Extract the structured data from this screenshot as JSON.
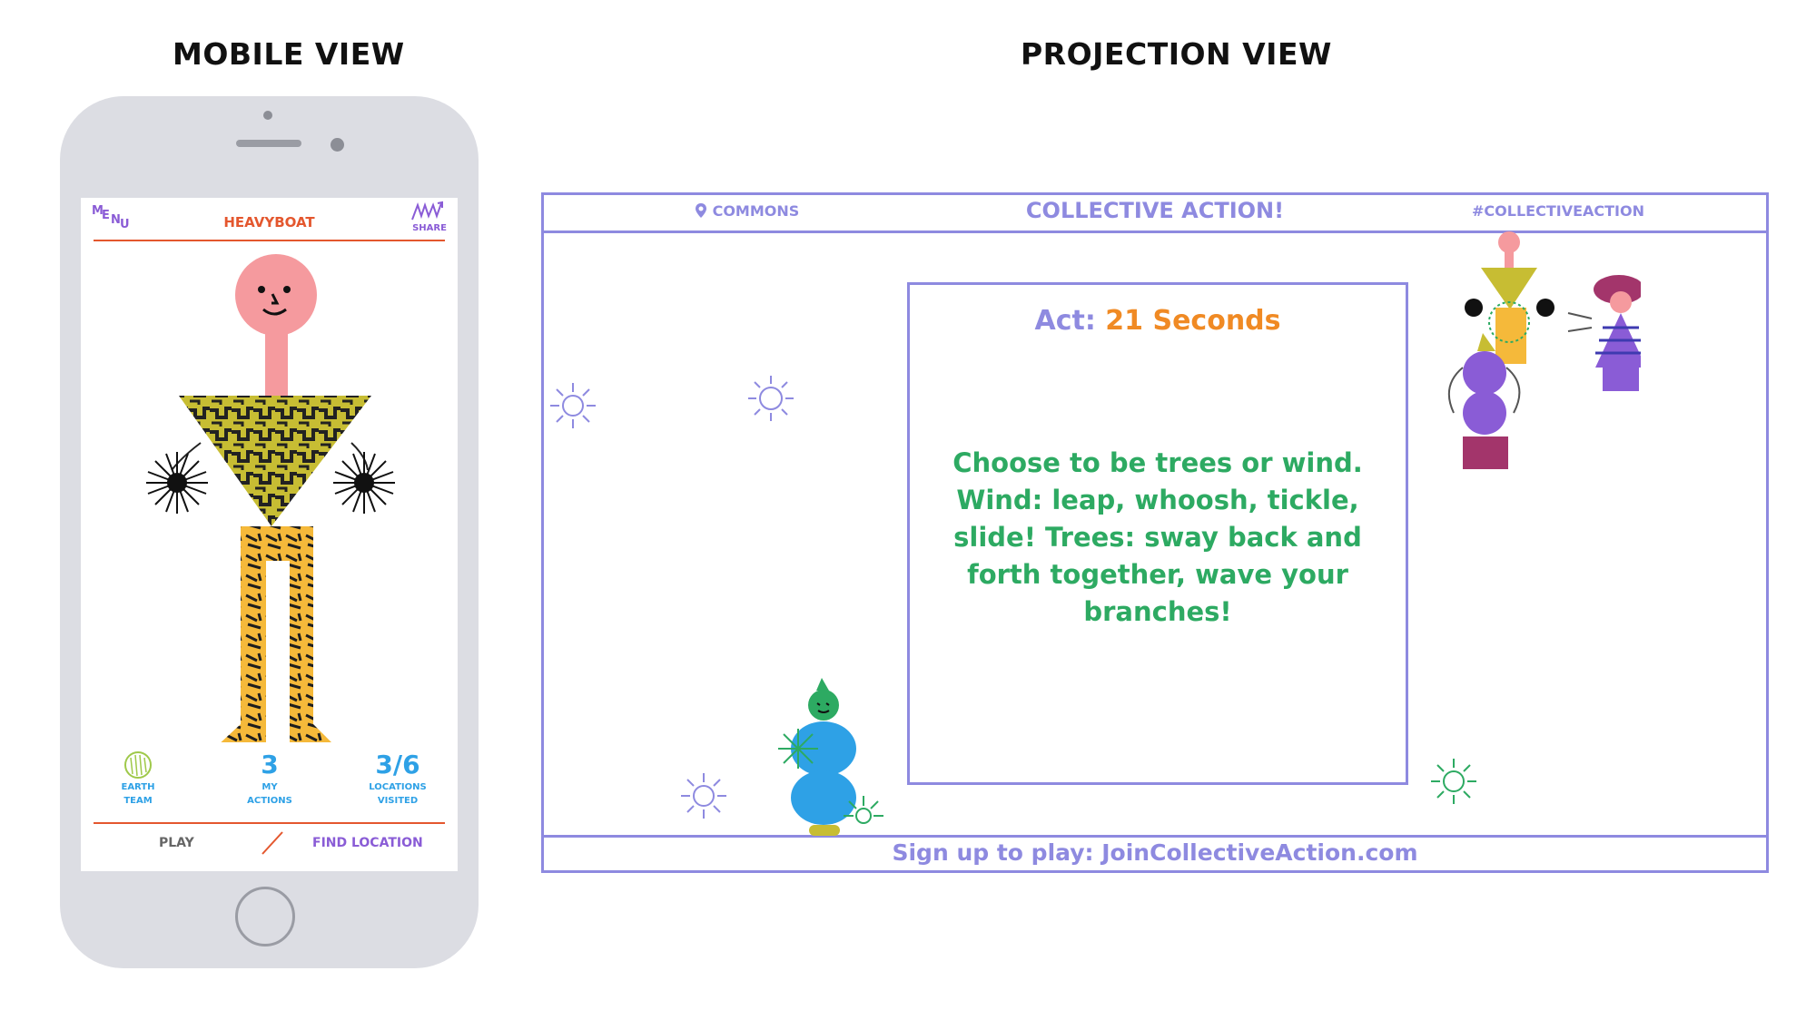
{
  "headings": {
    "mobile": "MOBILE VIEW",
    "projection": "PROJECTION VIEW"
  },
  "mobile": {
    "menu_label": "MENU",
    "menu_letters": [
      "M",
      "E",
      "N",
      "U"
    ],
    "app_name": "HEAVYBOAT",
    "share_label": "SHARE",
    "team_label": "EARTH\nTEAM",
    "stats": [
      {
        "value": "3",
        "label": "MY\nACTIONS"
      },
      {
        "value": "3/6",
        "label": "LOCATIONS\nVISITED"
      }
    ],
    "play_label": "PLAY",
    "find_location_label": "FIND LOCATION"
  },
  "projection": {
    "commons_label": "COMMONS",
    "title": "COLLECTIVE ACTION!",
    "hashtag": "#COLLECTIVEACTION",
    "act_label": "Act:",
    "act_timer": "21 Seconds",
    "instructions": "Choose to be trees or wind. Wind: leap, whoosh, tickle, slide! Trees: sway back and forth together, wave your branches!",
    "signup": "Sign up to play: JoinCollectiveAction.com"
  },
  "colors": {
    "brand_orange": "#e4572e",
    "purple": "#8a5cd6",
    "blue": "#2ea1e6",
    "periwinkle": "#8e8ae0",
    "green": "#2daa62",
    "timer_orange": "#f08a24",
    "phone_body": "#dcdde3"
  },
  "icons": [
    "share-wave-icon",
    "earth-team-icon",
    "location-pin-icon",
    "sun-icon"
  ]
}
